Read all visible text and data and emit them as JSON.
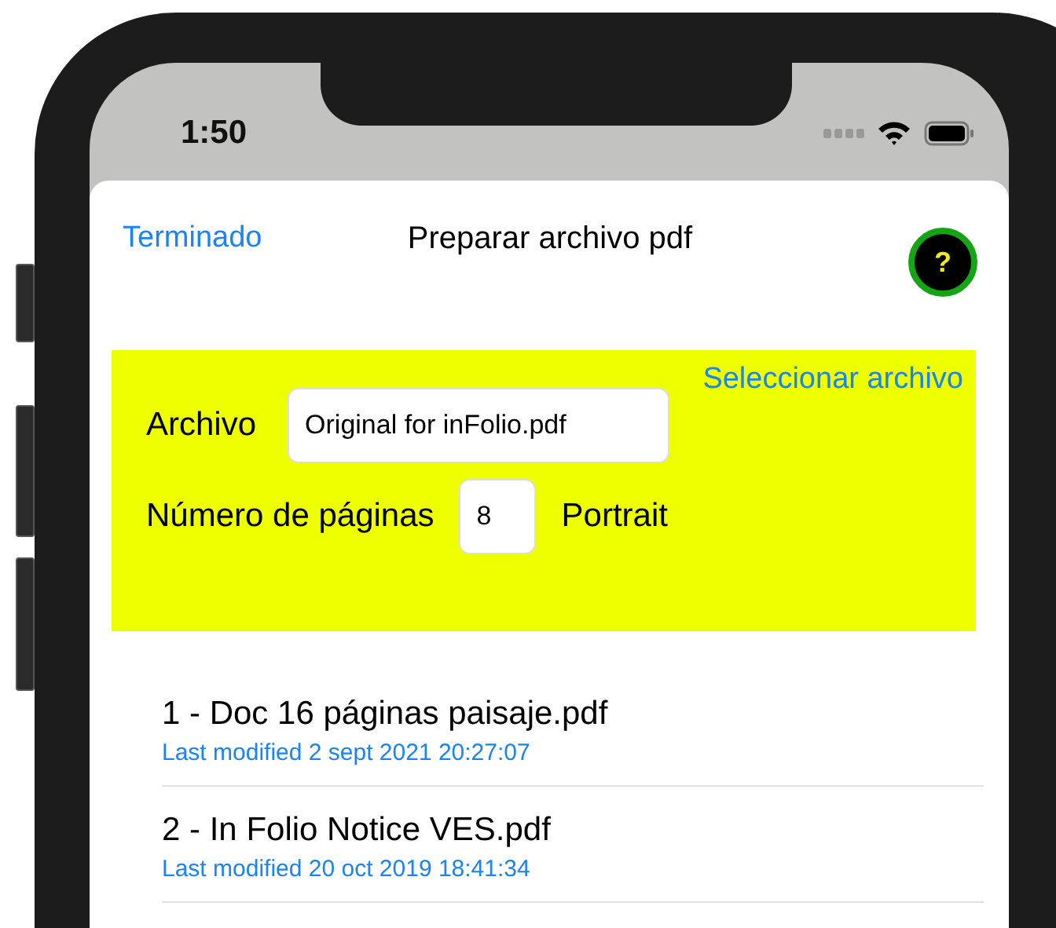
{
  "status_bar": {
    "time": "1:50"
  },
  "sheet": {
    "done_button": "Terminado",
    "title": "Preparar archivo pdf",
    "help_button": "?"
  },
  "file_panel": {
    "select_link": "Seleccionar archivo",
    "file_label": "Archivo",
    "file_value": "Original for inFolio.pdf",
    "pages_label": "Número de páginas",
    "pages_value": "8",
    "orientation": "Portrait"
  },
  "files": [
    {
      "name": "1 - Doc 16 páginas paisaje.pdf",
      "modified": "Last modified 2 sept 2021 20:27:07"
    },
    {
      "name": "2 - In Folio Notice VES.pdf",
      "modified": "Last modified 20 oct 2019 18:41:34"
    }
  ]
}
